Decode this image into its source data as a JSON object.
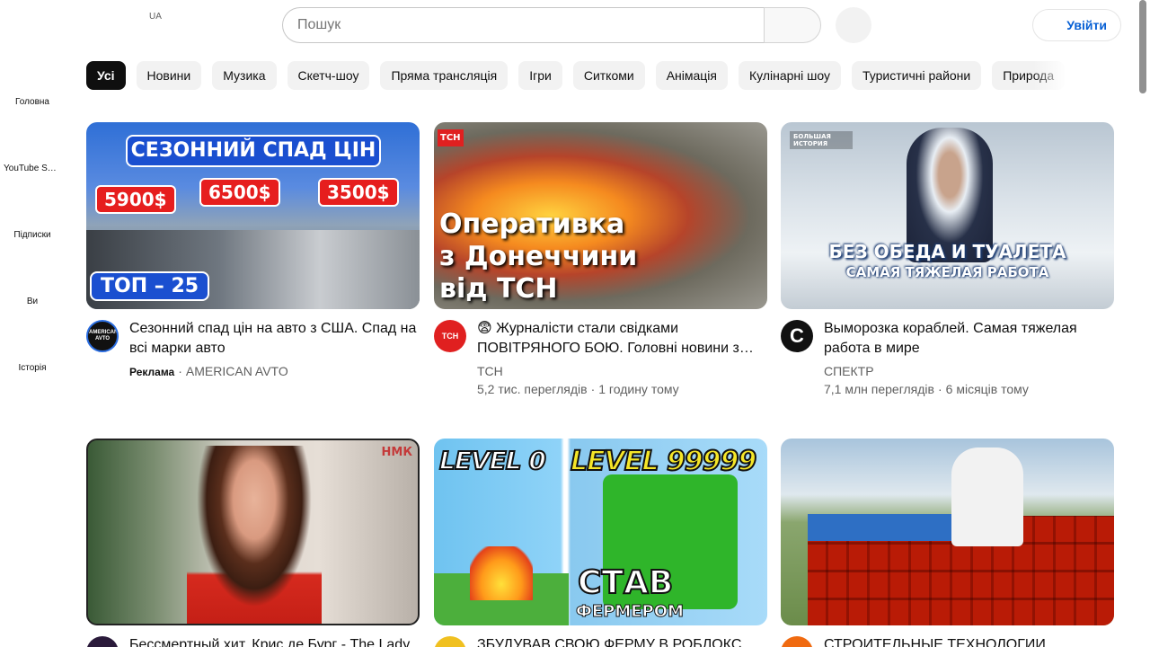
{
  "masthead": {
    "country_code": "UA",
    "search_placeholder": "Пошук",
    "sign_in_label": "Увійти"
  },
  "sidebar": {
    "items": [
      {
        "label": "Головна",
        "icon": "home-icon"
      },
      {
        "label": "YouTube Shorts",
        "icon": "shorts-icon"
      },
      {
        "label": "Підписки",
        "icon": "subscriptions-icon"
      },
      {
        "label": "Ви",
        "icon": "you-icon"
      },
      {
        "label": "Історія",
        "icon": "history-icon"
      }
    ]
  },
  "chips": [
    "Усі",
    "Новини",
    "Музика",
    "Скетч-шоу",
    "Пряма трансляція",
    "Ігри",
    "Ситкоми",
    "Анімація",
    "Кулінарні шоу",
    "Туристичні райони",
    "Природа"
  ],
  "videos": [
    {
      "title": "Сезонний спад цін на авто з США. Спад на всі марки авто",
      "ad_label": "Реклама",
      "channel": "AMERICAN AVTO",
      "views": "",
      "age": "",
      "avatar_text": "AMERICAN AVTO",
      "thumb_text": {
        "banner": "СЕЗОННИЙ СПАД ЦІН",
        "price1": "5900$",
        "price2": "6500$",
        "price3": "3500$",
        "badge": "ТОП – 25"
      }
    },
    {
      "title": "😨 Журналісти стали свідками ПОВІТРЯНОГО БОЮ. Головні новини з Донеччини",
      "channel": "ТСН",
      "views": "5,2 тис. переглядів",
      "age": "1 годину тому",
      "avatar_text": "ТСН",
      "thumb_text": {
        "logo": "ТСН",
        "line1": "Оперативка",
        "line2": "з Донеччини",
        "line3": "від ТСН"
      }
    },
    {
      "title": "Выморозка кораблей. Самая тяжелая работа в мире",
      "channel": "СПЕКТР",
      "views": "7,1 млн переглядів",
      "age": "6 місяців тому",
      "avatar_text": "C",
      "thumb_text": {
        "logo": "БОЛЬШАЯ ИСТОРИЯ",
        "line1": "БЕЗ ОБЕДА И ТУАЛЕТА",
        "line2": "САМАЯ ТЯЖЕЛАЯ РАБОТА"
      }
    },
    {
      "title": "Бессмертный хит. Крис де Бург - The Lady in Red",
      "channel": "",
      "views": "",
      "age": "",
      "avatar_text": "",
      "thumb_text": {
        "logo": "НМК"
      }
    },
    {
      "title": "ЗБУДУВАВ СВОЮ ФЕРМУ В РОБЛОКС",
      "channel": "",
      "views": "",
      "age": "",
      "avatar_text": "",
      "thumb_text": {
        "level0": "LEVEL 0",
        "level99": "LEVEL 99999",
        "line1": "СТАВ",
        "line2": "ФЕРМЕРОМ"
      }
    },
    {
      "title": "СТРОИТЕЛЬНЫЕ ТЕХНОЛОГИИ",
      "channel": "",
      "views": "",
      "age": "",
      "avatar_text": "",
      "thumb_text": {}
    }
  ],
  "colors": {
    "accent_blue": "#065fd4",
    "chip_bg": "#f2f2f2",
    "chip_active_bg": "#0f0f0f",
    "secondary_text": "#606060"
  }
}
